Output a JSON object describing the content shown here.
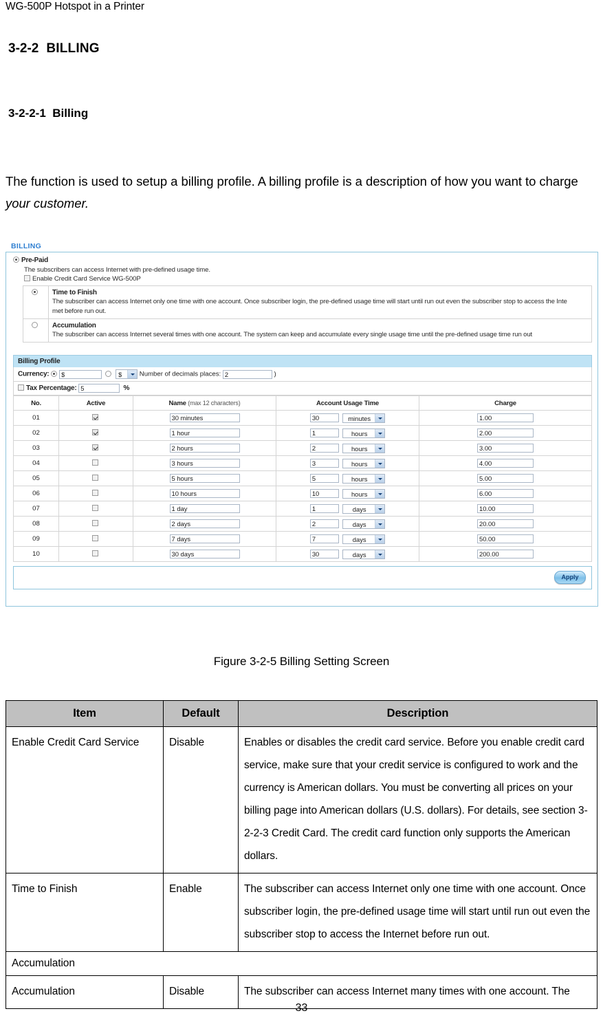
{
  "document": {
    "running_head": "WG-500P Hotspot in a Printer",
    "page_number": "33",
    "heading_section_number": "3-2-2",
    "heading_section_title": "BILLING",
    "heading_sub_number": "3-2-2-1",
    "heading_sub_title": "Billing",
    "intro_text_part1": "The function is used to setup a billing profile. A billing profile is a description of how you want to charge ",
    "intro_text_italic": "your customer.",
    "figure_caption": "Figure 3-2-5 Billing Setting Screen"
  },
  "screenshot": {
    "panel_title": "BILLING",
    "prepaid": {
      "label": "Pre-Paid",
      "selected": true,
      "description": "The subscribers can access Internet with pre-defined usage time.",
      "credit_card_checkbox_label": "Enable Credit Card Service WG-500P",
      "credit_card_checked": false
    },
    "modes": [
      {
        "selected": true,
        "name": "Time to Finish",
        "description_line1": "The subscriber can access Internet only one time with one account. Once subscriber login, the pre-defined usage time will start until run out even the subscriber stop to access the Inte",
        "description_line2": "met before run out."
      },
      {
        "selected": false,
        "name": "Accumulation",
        "description_line1": "The subscriber can access Internet several times with one account. The system can keep and accumulate every single usage time until the pre-defined usage time run out",
        "description_line2": ""
      }
    ],
    "billing_profile": {
      "section_title": "Billing Profile",
      "currency_label": "Currency:",
      "currency_radio_custom_selected": true,
      "currency_custom_value": "$",
      "currency_radio_list_selected": false,
      "currency_select_value": "$",
      "decimals_label": "Number of decimals places:",
      "decimals_value": "2",
      "decimals_close_paren": ")",
      "tax_checkbox_checked": false,
      "tax_label": "Tax Percentage:",
      "tax_value": "5",
      "tax_percent_sign": "%"
    },
    "table": {
      "headers": {
        "no": "No.",
        "active": "Active",
        "name": "Name",
        "name_hint": "(max 12 characters)",
        "usage": "Account Usage Time",
        "charge": "Charge"
      },
      "rows": [
        {
          "no": "01",
          "active": true,
          "name": "30 minutes",
          "qty": "30",
          "unit": "minutes",
          "charge": "1.00"
        },
        {
          "no": "02",
          "active": true,
          "name": "1 hour",
          "qty": "1",
          "unit": "hours",
          "charge": "2.00"
        },
        {
          "no": "03",
          "active": true,
          "name": "2 hours",
          "qty": "2",
          "unit": "hours",
          "charge": "3.00"
        },
        {
          "no": "04",
          "active": false,
          "name": "3 hours",
          "qty": "3",
          "unit": "hours",
          "charge": "4.00"
        },
        {
          "no": "05",
          "active": false,
          "name": "5 hours",
          "qty": "5",
          "unit": "hours",
          "charge": "5.00"
        },
        {
          "no": "06",
          "active": false,
          "name": "10 hours",
          "qty": "10",
          "unit": "hours",
          "charge": "6.00"
        },
        {
          "no": "07",
          "active": false,
          "name": "1 day",
          "qty": "1",
          "unit": "days",
          "charge": "10.00"
        },
        {
          "no": "08",
          "active": false,
          "name": "2 days",
          "qty": "2",
          "unit": "days",
          "charge": "20.00"
        },
        {
          "no": "09",
          "active": false,
          "name": "7 days",
          "qty": "7",
          "unit": "days",
          "charge": "50.00"
        },
        {
          "no": "10",
          "active": false,
          "name": "30 days",
          "qty": "30",
          "unit": "days",
          "charge": "200.00"
        }
      ]
    },
    "apply_button_label": "Apply",
    "colors": {
      "panel_title": "#2f7fd1",
      "frame_border": "#8fc5dd",
      "section_header_bg": "#bfe3f5"
    }
  },
  "description_table": {
    "headers": {
      "item": "Item",
      "default": "Default",
      "description": "Description"
    },
    "rows": [
      {
        "type": "data",
        "item": "Enable Credit Card Service",
        "default": "Disable",
        "description": "Enables or disables the credit card service. Before you enable credit card service, make sure that your credit service is configured to work and the currency is American dollars. You must be converting all prices on your billing page into American dollars (U.S. dollars). For details, see section 3-2-2-3 Credit Card. The credit card function only supports the American dollars."
      },
      {
        "type": "data",
        "item": "Time to Finish",
        "default": "Enable",
        "description": "The subscriber can access Internet only one time with one account. Once subscriber login, the pre-defined usage time will start until run out even the subscriber stop to access the Internet before run out."
      },
      {
        "type": "group",
        "item": "Accumulation",
        "default": "",
        "description": ""
      },
      {
        "type": "data",
        "item": "Accumulation",
        "default": "Disable",
        "description": "The subscriber can access Internet many times with one account. The"
      }
    ]
  }
}
